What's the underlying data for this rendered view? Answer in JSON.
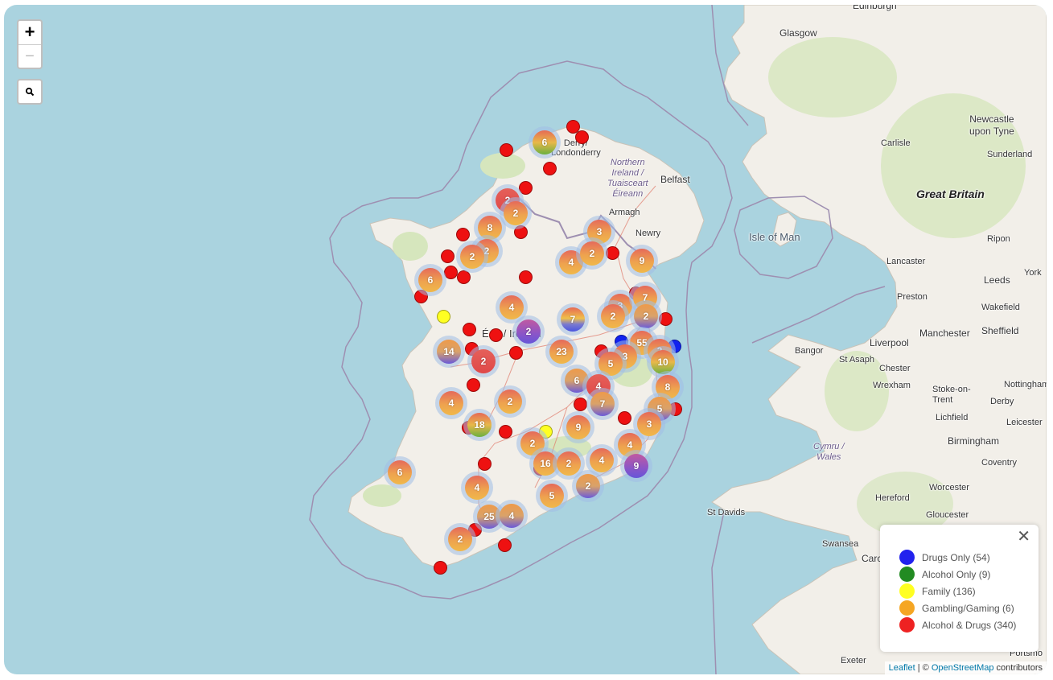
{
  "zoom": {
    "in_label": "+",
    "out_label": "−"
  },
  "labels": {
    "edinburgh": "Edinburgh",
    "glasgow": "Glasgow",
    "derry": "Derry/\nLondonderry",
    "northern_ireland": "Northern\nIreland /\nTuaisceart\nÉireann",
    "belfast": "Belfast",
    "armagh": "Armagh",
    "newry": "Newry",
    "isle_of_man": "Isle of Man",
    "great_britain": "Great Britain",
    "newcastle": "Newcastle\nupon Tyne",
    "carlisle": "Carlisle",
    "sunderland": "Sunderland",
    "ripon": "Ripon",
    "lancaster": "Lancaster",
    "york": "York",
    "leeds": "Leeds",
    "preston": "Preston",
    "wakefield": "Wakefield",
    "manchester": "Manchester",
    "sheffield": "Sheffield",
    "liverpool": "Liverpool",
    "bangor": "Bangor",
    "st_asaph": "St Asaph",
    "chester": "Chester",
    "wrexham": "Wrexham",
    "stoke": "Stoke-on-\nTrent",
    "nottingham": "Nottingham",
    "derby": "Derby",
    "lichfield": "Lichfield",
    "leicester": "Leicester",
    "birmingham": "Birmingham",
    "coventry": "Coventry",
    "cymru": "Cymru /\nWales",
    "worcester": "Worcester",
    "st_davids": "St Davids",
    "hereford": "Hereford",
    "gloucester": "Gloucester",
    "swansea": "Swansea",
    "cardiff": "Carc",
    "exeter": "Exeter",
    "portsmouth": "Portsmo",
    "eire": "É     / Ireland"
  },
  "clusters": [
    {
      "count": "6",
      "color": "green"
    },
    {
      "count": "2",
      "color": "red"
    },
    {
      "count": "2",
      "color": "orange"
    },
    {
      "count": "8",
      "color": "orange"
    },
    {
      "count": "2",
      "color": "orange"
    },
    {
      "count": "2",
      "color": "orange"
    },
    {
      "count": "6",
      "color": "orange"
    },
    {
      "count": "3",
      "color": "orange"
    },
    {
      "count": "4",
      "color": "orange"
    },
    {
      "count": "2",
      "color": "orange"
    },
    {
      "count": "9",
      "color": "orange"
    },
    {
      "count": "4",
      "color": "orange"
    },
    {
      "count": "7",
      "color": "rainbow"
    },
    {
      "count": "3",
      "color": "orange"
    },
    {
      "count": "7",
      "color": "orange"
    },
    {
      "count": "2",
      "color": "orange"
    },
    {
      "count": "2",
      "color": "blue"
    },
    {
      "count": "2",
      "color": "purple"
    },
    {
      "count": "55",
      "color": "orange"
    },
    {
      "count": "2",
      "color": "orange"
    },
    {
      "count": "14",
      "color": "blue"
    },
    {
      "count": "2",
      "color": "red"
    },
    {
      "count": "23",
      "color": "orange"
    },
    {
      "count": "3",
      "color": "orange"
    },
    {
      "count": "5",
      "color": "orange"
    },
    {
      "count": "10",
      "color": "green"
    },
    {
      "count": "6",
      "color": "blue"
    },
    {
      "count": "4",
      "color": "red"
    },
    {
      "count": "8",
      "color": "orange"
    },
    {
      "count": "4",
      "color": "orange"
    },
    {
      "count": "2",
      "color": "orange"
    },
    {
      "count": "7",
      "color": "blue"
    },
    {
      "count": "5",
      "color": "blue"
    },
    {
      "count": "18",
      "color": "green"
    },
    {
      "count": "9",
      "color": "orange"
    },
    {
      "count": "3",
      "color": "orange"
    },
    {
      "count": "2",
      "color": "orange"
    },
    {
      "count": "4",
      "color": "orange"
    },
    {
      "count": "16",
      "color": "orange"
    },
    {
      "count": "2",
      "color": "orange"
    },
    {
      "count": "4",
      "color": "orange"
    },
    {
      "count": "9",
      "color": "purple"
    },
    {
      "count": "2",
      "color": "blue"
    },
    {
      "count": "6",
      "color": "orange"
    },
    {
      "count": "4",
      "color": "orange"
    },
    {
      "count": "5",
      "color": "orange"
    },
    {
      "count": "25",
      "color": "blue"
    },
    {
      "count": "4",
      "color": "blue"
    },
    {
      "count": "2",
      "color": "orange"
    }
  ],
  "markers": [
    {
      "type": "alcohol_drugs"
    },
    {
      "type": "alcohol_drugs"
    },
    {
      "type": "alcohol_drugs"
    },
    {
      "type": "alcohol_drugs"
    },
    {
      "type": "alcohol_drugs"
    },
    {
      "type": "alcohol_drugs"
    },
    {
      "type": "alcohol_drugs"
    },
    {
      "type": "alcohol_drugs"
    },
    {
      "type": "alcohol_drugs"
    },
    {
      "type": "alcohol_drugs"
    },
    {
      "type": "alcohol_drugs"
    },
    {
      "type": "alcohol_drugs"
    },
    {
      "type": "alcohol_drugs"
    },
    {
      "type": "family"
    },
    {
      "type": "alcohol_drugs"
    },
    {
      "type": "alcohol_drugs"
    },
    {
      "type": "alcohol_drugs"
    },
    {
      "type": "alcohol_drugs"
    },
    {
      "type": "alcohol_drugs"
    },
    {
      "type": "alcohol_drugs"
    },
    {
      "type": "drugs"
    },
    {
      "type": "drugs"
    },
    {
      "type": "alcohol_drugs"
    },
    {
      "type": "alcohol_drugs"
    },
    {
      "type": "alcohol_drugs"
    },
    {
      "type": "alcohol_drugs"
    },
    {
      "type": "alcohol_drugs"
    },
    {
      "type": "family"
    },
    {
      "type": "alcohol_drugs"
    },
    {
      "type": "alcohol_drugs"
    },
    {
      "type": "alcohol_drugs"
    },
    {
      "type": "alcohol_drugs"
    },
    {
      "type": "alcohol_drugs"
    },
    {
      "type": "alcohol_drugs"
    },
    {
      "type": "alcohol_drugs"
    }
  ],
  "legend": {
    "close_label": "✕",
    "items": [
      {
        "label": "Drugs Only (54)",
        "color": "#2222ee"
      },
      {
        "label": "Alcohol Only (9)",
        "color": "#228b22"
      },
      {
        "label": "Family (136)",
        "color": "#ffff22"
      },
      {
        "label": "Gambling/Gaming (6)",
        "color": "#f5a623"
      },
      {
        "label": "Alcohol & Drugs (340)",
        "color": "#ee2222"
      }
    ]
  },
  "attribution": {
    "leaflet": "Leaflet",
    "sep": " | © ",
    "osm": "OpenStreetMap",
    "suffix": " contributors"
  },
  "colors": {
    "sea": "#aad3df",
    "land": "#f2efe9",
    "green_land": "#cfe3b4",
    "border": "#9e8fb1"
  }
}
